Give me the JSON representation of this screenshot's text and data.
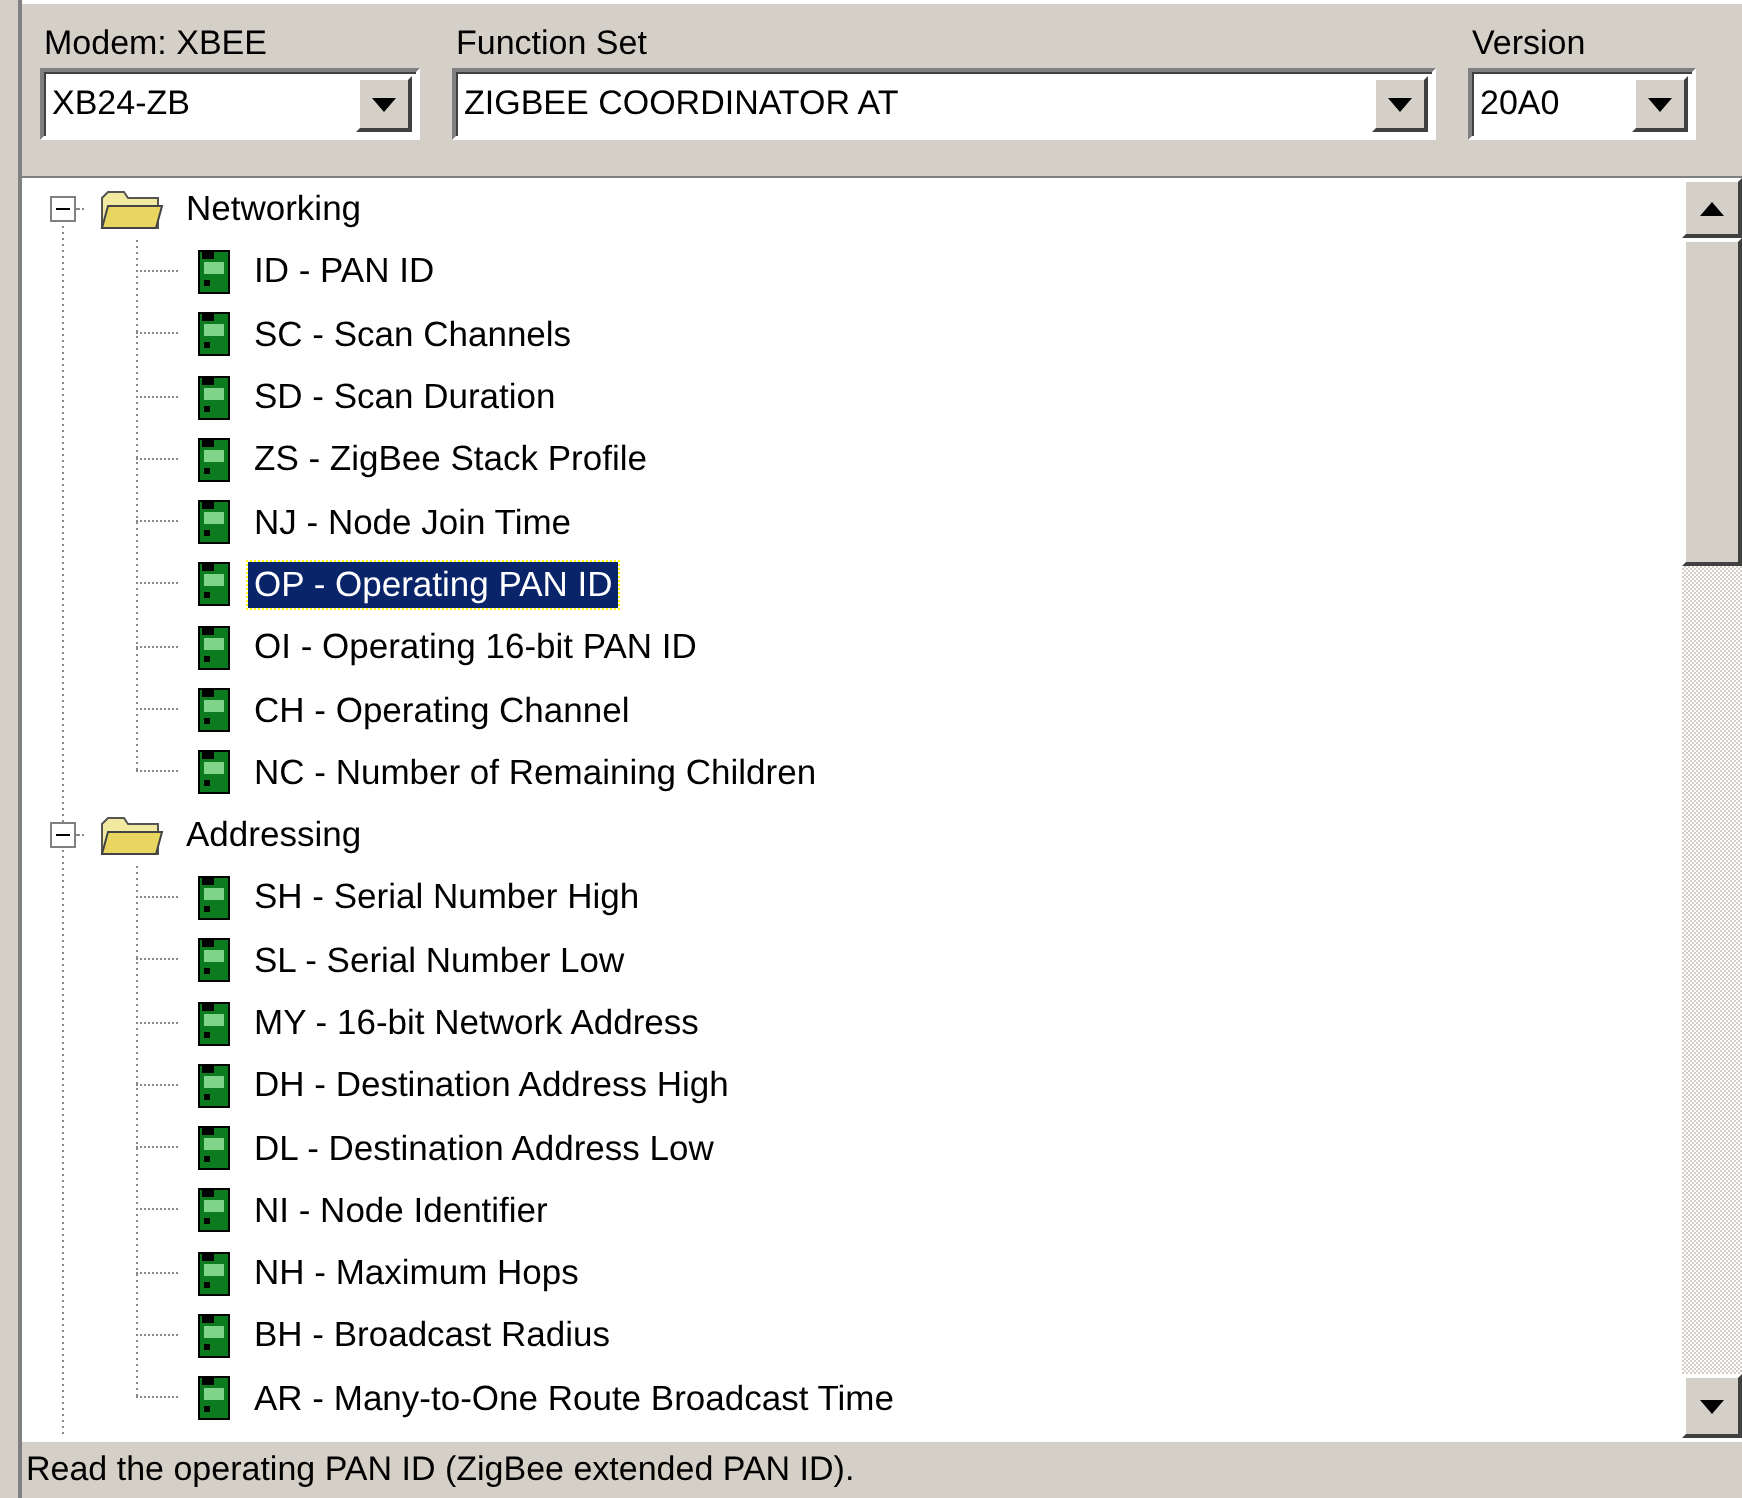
{
  "selectors": [
    {
      "label": "Modem: XBEE",
      "value": "XB24-ZB",
      "kind": "narrow"
    },
    {
      "label": "Function Set",
      "value": "ZIGBEE COORDINATOR AT",
      "kind": "wide"
    },
    {
      "label": "Version",
      "value": "20A0",
      "kind": "small"
    }
  ],
  "tree": {
    "groups": [
      {
        "label": "Networking",
        "expanded": true,
        "children": [
          {
            "label": "ID - PAN ID",
            "selected": false
          },
          {
            "label": "SC - Scan Channels",
            "selected": false
          },
          {
            "label": "SD - Scan Duration",
            "selected": false
          },
          {
            "label": "ZS - ZigBee Stack Profile",
            "selected": false
          },
          {
            "label": "NJ - Node Join Time",
            "selected": false
          },
          {
            "label": "OP - Operating PAN ID",
            "selected": true
          },
          {
            "label": "OI - Operating 16-bit PAN ID",
            "selected": false
          },
          {
            "label": "CH - Operating Channel",
            "selected": false
          },
          {
            "label": "NC - Number of Remaining Children",
            "selected": false
          }
        ]
      },
      {
        "label": "Addressing",
        "expanded": true,
        "children": [
          {
            "label": "SH - Serial Number High",
            "selected": false
          },
          {
            "label": "SL - Serial Number Low",
            "selected": false
          },
          {
            "label": "MY - 16-bit Network Address",
            "selected": false
          },
          {
            "label": "DH - Destination Address High",
            "selected": false
          },
          {
            "label": "DL - Destination Address Low",
            "selected": false
          },
          {
            "label": "NI - Node Identifier",
            "selected": false
          },
          {
            "label": "NH - Maximum Hops",
            "selected": false
          },
          {
            "label": "BH - Broadcast Radius",
            "selected": false
          },
          {
            "label": "AR - Many-to-One Route Broadcast Time",
            "selected": false
          }
        ]
      }
    ]
  },
  "status_bar": "Read the operating PAN ID (ZigBee extended PAN ID)."
}
